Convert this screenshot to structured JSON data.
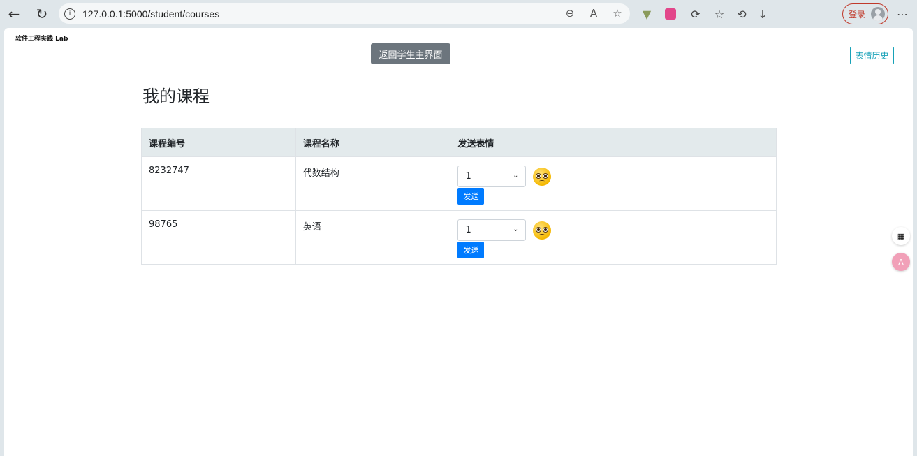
{
  "browser": {
    "url": "127.0.0.1:5000/student/courses",
    "login_label": "登录"
  },
  "page": {
    "brand": "软件工程实践 Lab",
    "back_button": "返回学生主界面",
    "history_button": "表情历史",
    "title": "我的课程"
  },
  "table": {
    "headers": [
      "课程编号",
      "课程名称",
      "发送表情"
    ],
    "rows": [
      {
        "id": "8232747",
        "name": "代数结构",
        "selected": "1",
        "send": "发送"
      },
      {
        "id": "98765",
        "name": "英语",
        "selected": "1",
        "send": "发送"
      }
    ]
  },
  "colors": {
    "secondary_button": "#6c757d",
    "primary_button": "#007bff",
    "info_outline": "#17a2b8",
    "table_header_bg": "#e3eaec"
  },
  "icons": {
    "emoji": "pleading-face"
  }
}
